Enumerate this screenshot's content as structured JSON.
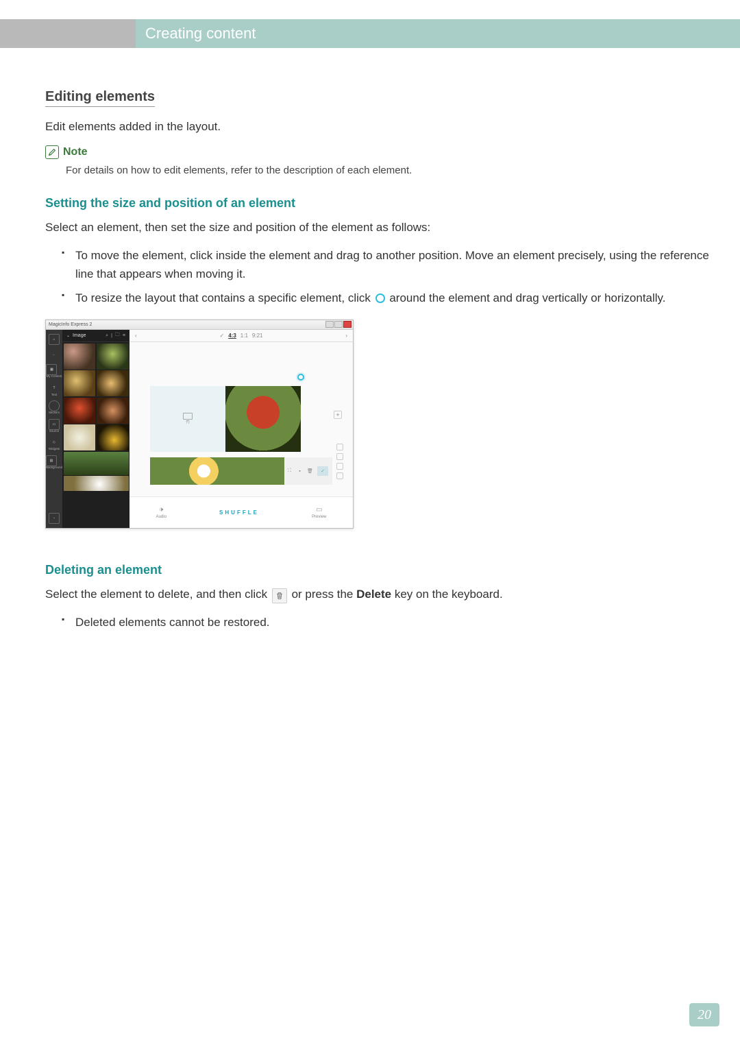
{
  "header": {
    "title": "Creating content"
  },
  "section1": {
    "heading": "Editing elements",
    "intro": "Edit elements added in the layout."
  },
  "note": {
    "label": "Note",
    "text": "For details on how to edit elements, refer to the description of each element."
  },
  "section2": {
    "heading": "Setting the size and position of an element",
    "intro": "Select an element, then set the size and position of the element as follows:",
    "bullets": {
      "b1": "To move the element, click inside the element and drag to another position. Move an element precisely, using the reference line that appears when moving it.",
      "b2_pre": "To resize the layout that contains a specific element, click ",
      "b2_post": " around the element and drag vertically or horizontally."
    }
  },
  "app": {
    "window_title": "MagicInfo Express 2",
    "panel_label": "Image",
    "side": {
      "my_content": "My Content",
      "text": "Text",
      "stickers": "Stickers",
      "source": "Source",
      "widgets": "Widgets",
      "background": "Background"
    },
    "toolbar": {
      "ratio_a": "4:3",
      "ratio_b": "1:1",
      "ratio_c": "9:21"
    },
    "slot_tv": "TV",
    "bottom": {
      "audio": "Audio",
      "shuffle": "SHUFFLE",
      "preview": "Preview"
    }
  },
  "section3": {
    "heading": "Deleting an element",
    "line_pre": "Select the element to delete, and then click ",
    "line_mid": " or press the ",
    "delete_key": "Delete",
    "line_post": " key on the keyboard.",
    "bullet1": "Deleted elements cannot be restored."
  },
  "page_number": "20"
}
